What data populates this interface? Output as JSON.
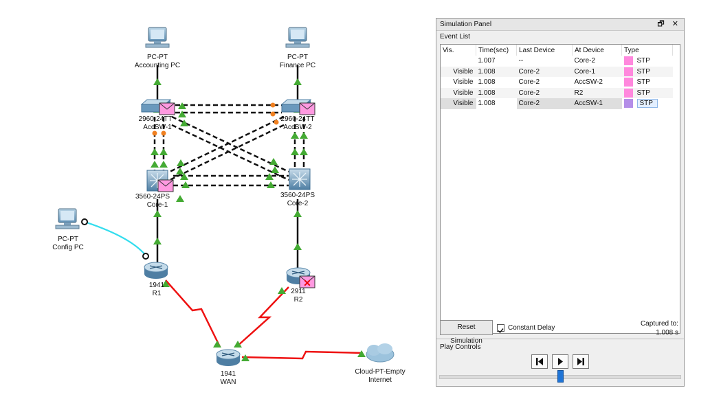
{
  "topology": {
    "devices": {
      "accounting_pc": {
        "model": "PC-PT",
        "name": "Accounting PC"
      },
      "finance_pc": {
        "model": "PC-PT",
        "name": "Finance PC"
      },
      "accsw1": {
        "model": "2960-24TT",
        "name": "AccSW-1"
      },
      "accsw2": {
        "model": "2960-24TT",
        "name": "AccSW-2"
      },
      "core1": {
        "model": "3560-24PS",
        "name": "Core-1"
      },
      "core2": {
        "model": "3560-24PS",
        "name": "Core-2"
      },
      "config_pc": {
        "model": "PC-PT",
        "name": "Config PC"
      },
      "r1": {
        "model": "1941",
        "name": "R1"
      },
      "r2": {
        "model": "2911",
        "name": "R2"
      },
      "wan": {
        "model": "1941",
        "name": "WAN"
      },
      "cloud": {
        "model": "Cloud-PT-Empty",
        "name": "Internet"
      }
    },
    "colors": {
      "link_green": "#44aa33",
      "link_orange": "#f08020",
      "serial_red": "#ee1111",
      "console_cyan": "#33ddee",
      "stp_pink": "#ff88dd"
    }
  },
  "panel": {
    "title": "Simulation Panel",
    "title_buttons": "🗗 ✕",
    "event_list_label": "Event List",
    "columns": [
      "Vis.",
      "Time(sec)",
      "Last Device",
      "At Device",
      "Type"
    ],
    "events": [
      {
        "vis": "",
        "time": "1.007",
        "last": "--",
        "at": "Core-2",
        "type": "STP",
        "color": "#ff88dd"
      },
      {
        "vis": "Visible",
        "time": "1.008",
        "last": "Core-2",
        "at": "Core-1",
        "type": "STP",
        "color": "#ff88dd"
      },
      {
        "vis": "Visible",
        "time": "1.008",
        "last": "Core-2",
        "at": "AccSW-2",
        "type": "STP",
        "color": "#ff88dd"
      },
      {
        "vis": "Visible",
        "time": "1.008",
        "last": "Core-2",
        "at": "R2",
        "type": "STP",
        "color": "#ff88dd"
      },
      {
        "vis": "Visible",
        "time": "1.008",
        "last": "Core-2",
        "at": "AccSW-1",
        "type": "STP",
        "color": "#b48ee8"
      }
    ],
    "reset_label": "Reset Simulation",
    "constant_delay_label": "Constant Delay",
    "constant_delay_checked": true,
    "captured_label": "Captured to:",
    "captured_value": "1.008 s",
    "play_controls_label": "Play Controls",
    "slider_position": 0.49
  }
}
